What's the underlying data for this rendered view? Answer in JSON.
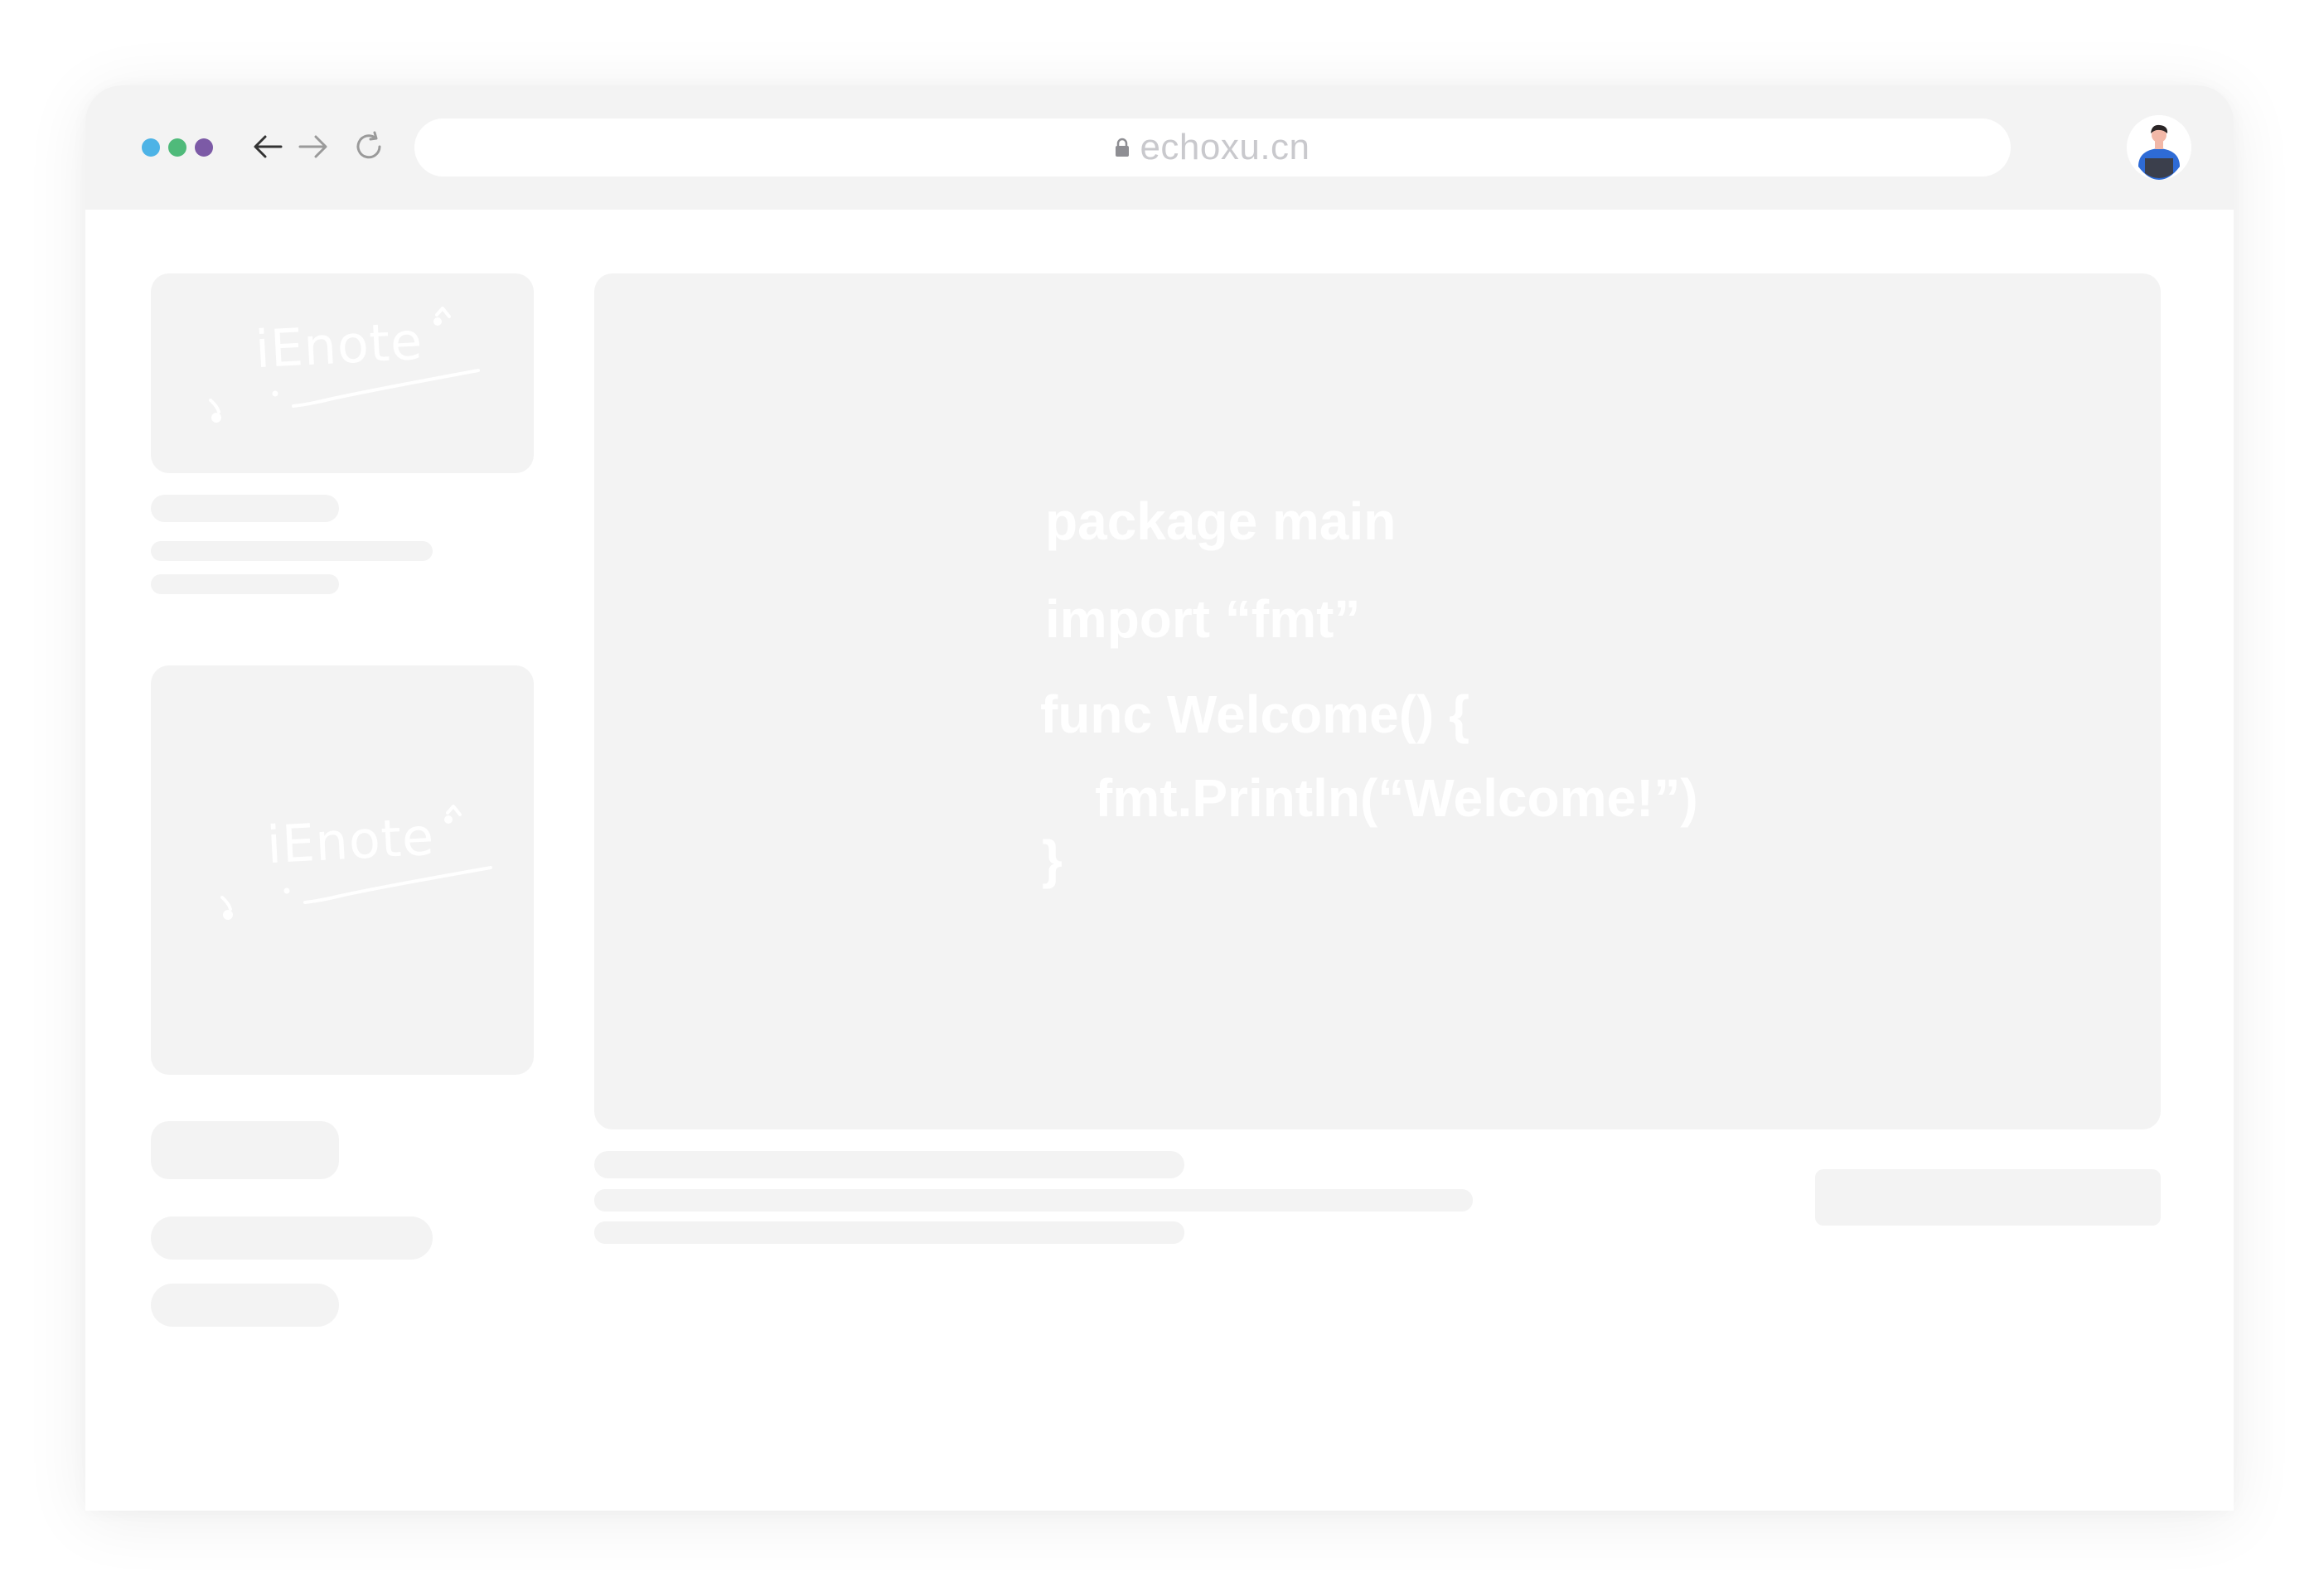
{
  "browser": {
    "url": "echoxu.cn",
    "traffic_lights": [
      "#4db3e6",
      "#4fba7a",
      "#7c5aa6"
    ]
  },
  "sidebar": {
    "logo_cards": [
      {
        "label": "iEnote"
      },
      {
        "label": "iEnote"
      }
    ]
  },
  "main": {
    "code": [
      "package main",
      "import “fmt”",
      "func Welcome() {",
      "fmt.Println(“Welcome!”)",
      "}"
    ]
  },
  "colors": {
    "chrome": "#f3f3f3",
    "placeholder": "#f3f3f3",
    "code_text": "#ffffff"
  }
}
